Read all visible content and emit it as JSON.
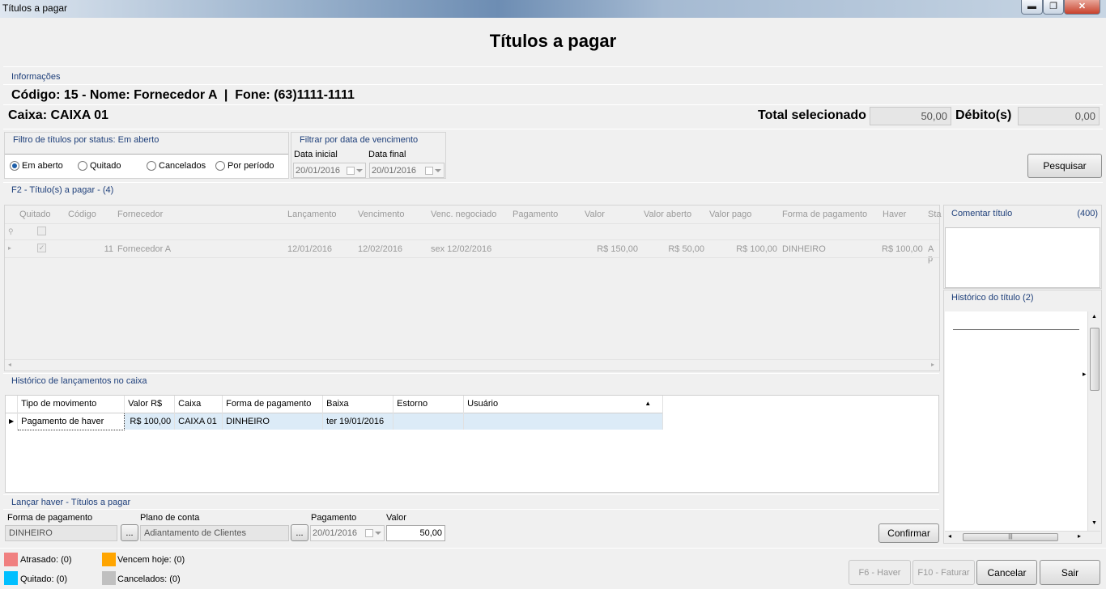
{
  "window": {
    "title": "Títulos a pagar",
    "minimize": "▬",
    "maximize": "❐",
    "close": "✕"
  },
  "page_title": "Títulos a pagar",
  "info": {
    "group_label": "Informações",
    "supplier_line": "Código: 15 - Nome: Fornecedor A  |  Fone: (63)1111-1111",
    "caixa": "Caixa: CAIXA 01",
    "total_selecionado_label": "Total selecionado",
    "total_selecionado_value": "50,00",
    "debitos_label": "Débito(s)",
    "debitos_value": "0,00"
  },
  "status_filter": {
    "label": "Filtro de títulos por status: Em aberto",
    "options": [
      "Em aberto",
      "Quitado",
      "Cancelados",
      "Por período"
    ],
    "selected": "Em aberto"
  },
  "date_filter": {
    "label": "Filtrar por data de vencimento",
    "start_label": "Data inicial",
    "start_value": "20/01/2016",
    "end_label": "Data final",
    "end_value": "20/01/2016"
  },
  "search_button": "Pesquisar",
  "titles_grid": {
    "label": "F2 - Título(s) a pagar - (4)",
    "columns": [
      "Quitado",
      "Código",
      "Fornecedor",
      "Lançamento",
      "Vencimento",
      "Venc. negociado",
      "Pagamento",
      "Valor",
      "Valor aberto",
      "Valor pago",
      "Forma de pagamento",
      "Haver",
      "Sta"
    ],
    "row": {
      "codigo": "11",
      "fornecedor": "Fornecedor A",
      "lancamento": "12/01/2016",
      "vencimento": "12/02/2016",
      "venc_negociado": "sex 12/02/2016",
      "pagamento": "",
      "valor": "R$ 150,00",
      "valor_aberto": "R$ 50,00",
      "valor_pago": "R$ 100,00",
      "forma": "DINHEIRO",
      "haver": "R$ 100,00",
      "status": "A p"
    }
  },
  "comment_panel": {
    "label": "Comentar título",
    "count": "(400)"
  },
  "history_panel": {
    "label": "Histórico do título (2)"
  },
  "cash_history": {
    "label": "Histórico de lançamentos no caixa",
    "columns": [
      "Tipo de movimento",
      "Valor R$",
      "Caixa",
      "Forma de pagamento",
      "Baixa",
      "Estorno",
      "Usuário"
    ],
    "rows": [
      {
        "tipo": "Pagamento de haver",
        "valor": "R$ 100,00",
        "caixa": "CAIXA 01",
        "forma": "DINHEIRO",
        "baixa": "ter 19/01/2016",
        "estorno": "",
        "usuario": ""
      }
    ]
  },
  "haver": {
    "label": "Lançar haver - Títulos a pagar",
    "forma_label": "Forma de pagamento",
    "forma_value": "DINHEIRO",
    "plano_label": "Plano de conta",
    "plano_value": "Adiantamento de Clientes",
    "pagamento_label": "Pagamento",
    "pagamento_value": "20/01/2016",
    "valor_label": "Valor",
    "valor_value": "50,00",
    "browse": "...",
    "confirm": "Confirmar"
  },
  "legend": [
    {
      "label": "Atrasado: (0)",
      "color": "#f08080"
    },
    {
      "label": "Vencem hoje: (0)",
      "color": "#ffa500"
    },
    {
      "label": "Quitado: (0)",
      "color": "#00bfff"
    },
    {
      "label": "Cancelados: (0)",
      "color": "#c0c0c0"
    }
  ],
  "footer_buttons": {
    "haver": "F6 - Haver",
    "faturar": "F10 - Faturar",
    "cancelar": "Cancelar",
    "sair": "Sair"
  }
}
